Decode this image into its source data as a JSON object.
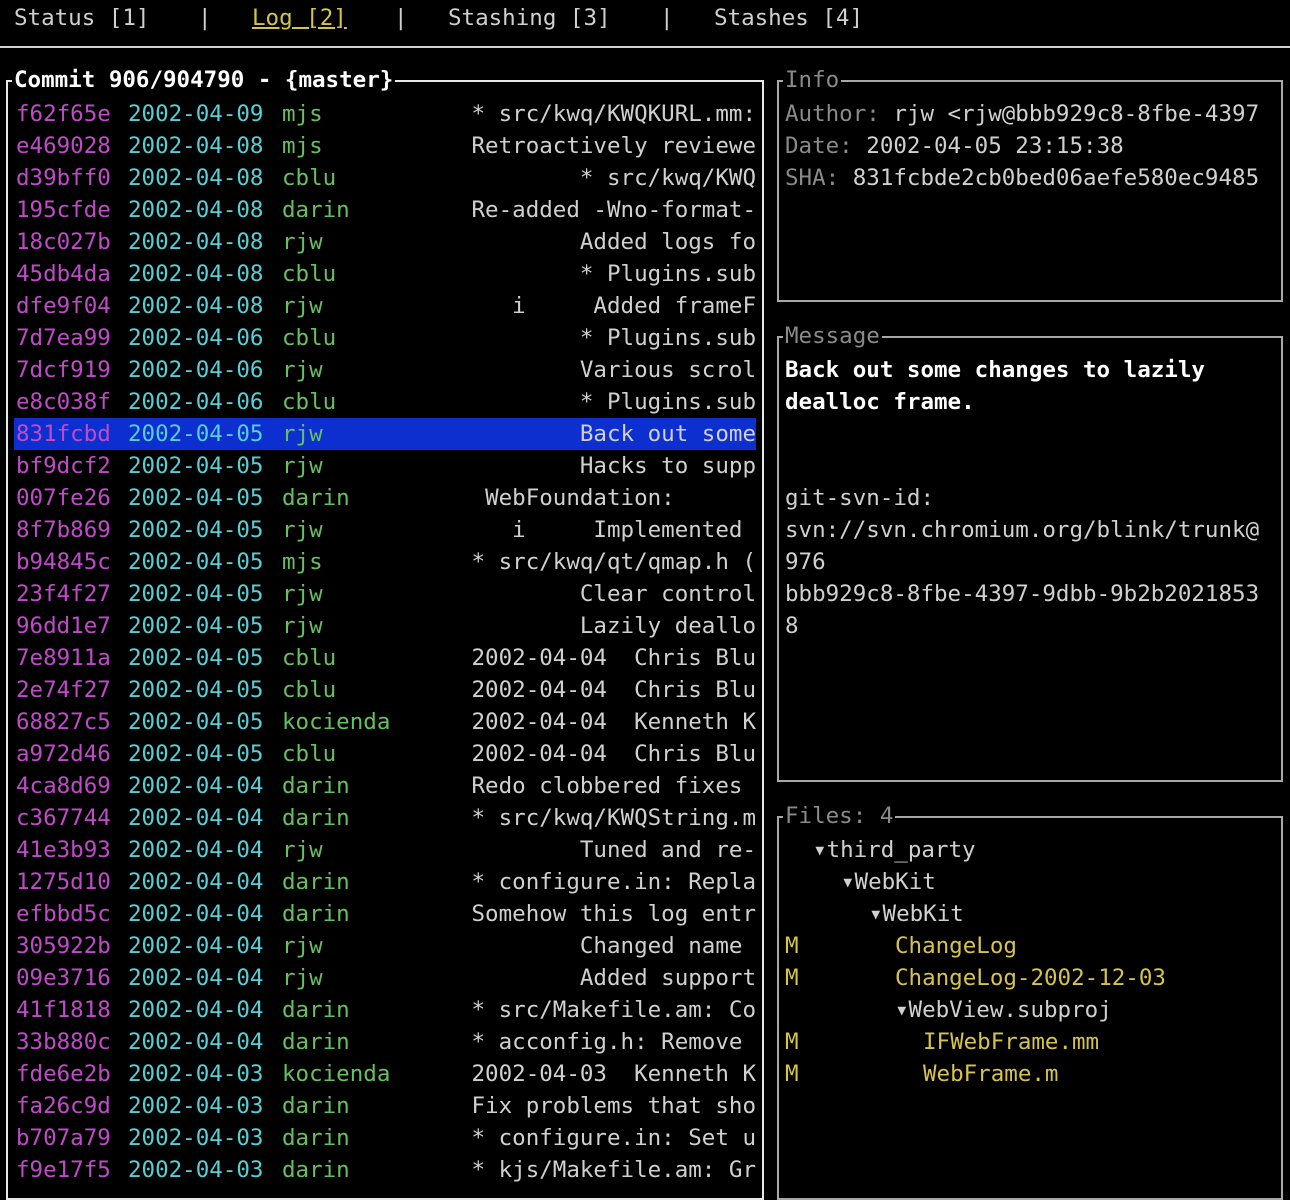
{
  "tabs": [
    {
      "label": "Status [1]",
      "active": false
    },
    {
      "label": "Log [2]",
      "active": true
    },
    {
      "label": "Stashing [3]",
      "active": false
    },
    {
      "label": "Stashes [4]",
      "active": false
    }
  ],
  "tab_separator": "|",
  "log": {
    "title": "Commit 906/904790 - {master}",
    "selected_index": 10,
    "commits": [
      {
        "sha": "f62f65e",
        "date": "2002-04-09",
        "author": "mjs",
        "msg": "* src/kwq/KWQKURL.mm:"
      },
      {
        "sha": "e469028",
        "date": "2002-04-08",
        "author": "mjs",
        "msg": "Retroactively reviewe"
      },
      {
        "sha": "d39bff0",
        "date": "2002-04-08",
        "author": "cblu",
        "msg": "* src/kwq/KWQ"
      },
      {
        "sha": "195cfde",
        "date": "2002-04-08",
        "author": "darin",
        "msg": "Re-added -Wno-format-"
      },
      {
        "sha": "18c027b",
        "date": "2002-04-08",
        "author": "rjw",
        "msg": "Added logs fo"
      },
      {
        "sha": "45db4da",
        "date": "2002-04-08",
        "author": "cblu",
        "msg": "* Plugins.sub"
      },
      {
        "sha": "dfe9f04",
        "date": "2002-04-08",
        "author": "rjw",
        "msg": "i     Added frameF"
      },
      {
        "sha": "7d7ea99",
        "date": "2002-04-06",
        "author": "cblu",
        "msg": "* Plugins.sub"
      },
      {
        "sha": "7dcf919",
        "date": "2002-04-06",
        "author": "rjw",
        "msg": "Various scrol"
      },
      {
        "sha": "e8c038f",
        "date": "2002-04-06",
        "author": "cblu",
        "msg": "* Plugins.sub"
      },
      {
        "sha": "831fcbd",
        "date": "2002-04-05",
        "author": "rjw",
        "msg": "Back out some"
      },
      {
        "sha": "bf9dcf2",
        "date": "2002-04-05",
        "author": "rjw",
        "msg": "Hacks to supp"
      },
      {
        "sha": "007fe26",
        "date": "2002-04-05",
        "author": "darin",
        "msg": "WebFoundation:      "
      },
      {
        "sha": "8f7b869",
        "date": "2002-04-05",
        "author": "rjw",
        "msg": "i     Implemented "
      },
      {
        "sha": "b94845c",
        "date": "2002-04-05",
        "author": "mjs",
        "msg": "* src/kwq/qt/qmap.h ("
      },
      {
        "sha": "23f4f27",
        "date": "2002-04-05",
        "author": "rjw",
        "msg": "Clear control"
      },
      {
        "sha": "96dd1e7",
        "date": "2002-04-05",
        "author": "rjw",
        "msg": "Lazily deallo"
      },
      {
        "sha": "7e8911a",
        "date": "2002-04-05",
        "author": "cblu",
        "msg": "2002-04-04  Chris Blu"
      },
      {
        "sha": "2e74f27",
        "date": "2002-04-05",
        "author": "cblu",
        "msg": "2002-04-04  Chris Blu"
      },
      {
        "sha": "68827c5",
        "date": "2002-04-05",
        "author": "kocienda",
        "msg": "2002-04-04  Kenneth K"
      },
      {
        "sha": "a972d46",
        "date": "2002-04-05",
        "author": "cblu",
        "msg": "2002-04-04  Chris Blu"
      },
      {
        "sha": "4ca8d69",
        "date": "2002-04-04",
        "author": "darin",
        "msg": "Redo clobbered fixes "
      },
      {
        "sha": "c367744",
        "date": "2002-04-04",
        "author": "darin",
        "msg": "* src/kwq/KWQString.m"
      },
      {
        "sha": "41e3b93",
        "date": "2002-04-04",
        "author": "rjw",
        "msg": "Tuned and re-"
      },
      {
        "sha": "1275d10",
        "date": "2002-04-04",
        "author": "darin",
        "msg": "* configure.in: Repla"
      },
      {
        "sha": "efbbd5c",
        "date": "2002-04-04",
        "author": "darin",
        "msg": "Somehow this log entr"
      },
      {
        "sha": "305922b",
        "date": "2002-04-04",
        "author": "rjw",
        "msg": "Changed name "
      },
      {
        "sha": "09e3716",
        "date": "2002-04-04",
        "author": "rjw",
        "msg": "Added support"
      },
      {
        "sha": "41f1818",
        "date": "2002-04-04",
        "author": "darin",
        "msg": "* src/Makefile.am: Co"
      },
      {
        "sha": "33b880c",
        "date": "2002-04-04",
        "author": "darin",
        "msg": "* acconfig.h: Remove "
      },
      {
        "sha": "fde6e2b",
        "date": "2002-04-03",
        "author": "kocienda",
        "msg": "2002-04-03  Kenneth K"
      },
      {
        "sha": "fa26c9d",
        "date": "2002-04-03",
        "author": "darin",
        "msg": "Fix problems that sho"
      },
      {
        "sha": "b707a79",
        "date": "2002-04-03",
        "author": "darin",
        "msg": "* configure.in: Set u"
      },
      {
        "sha": "f9e17f5",
        "date": "2002-04-03",
        "author": "darin",
        "msg": "* kjs/Makefile.am: Gr"
      }
    ]
  },
  "info": {
    "title": "Info",
    "author_label": "Author: ",
    "author_value": "rjw <rjw@bbb929c8-8fbe-4397",
    "date_label": "Date: ",
    "date_value": "2002-04-05 23:15:38",
    "sha_label": "SHA: ",
    "sha_value": "831fcbde2cb0bed06aefe580ec9485"
  },
  "message": {
    "title": "Message",
    "lines": [
      {
        "text": "Back out some changes to lazily",
        "bold": true
      },
      {
        "text": "dealloc frame.",
        "bold": true
      },
      {
        "text": "",
        "bold": false
      },
      {
        "text": "",
        "bold": false
      },
      {
        "text": "git-svn-id:",
        "bold": false
      },
      {
        "text": "svn://svn.chromium.org/blink/trunk@",
        "bold": false
      },
      {
        "text": "976",
        "bold": false
      },
      {
        "text": "bbb929c8-8fbe-4397-9dbb-9b2b2021853",
        "bold": false
      },
      {
        "text": "8",
        "bold": false
      }
    ]
  },
  "files": {
    "title": "Files: 4",
    "tree": [
      {
        "status": "",
        "name": "▾third_party",
        "kind": "dir",
        "depth": 1
      },
      {
        "status": "",
        "name": "▾WebKit",
        "kind": "dir",
        "depth": 2
      },
      {
        "status": "",
        "name": "▾WebKit",
        "kind": "dir",
        "depth": 3
      },
      {
        "status": "M",
        "name": "ChangeLog",
        "kind": "file",
        "depth": 4
      },
      {
        "status": "M",
        "name": "ChangeLog-2002-12-03",
        "kind": "file",
        "depth": 4
      },
      {
        "status": "",
        "name": "▾WebView.subproj",
        "kind": "dir",
        "depth": 4
      },
      {
        "status": "M",
        "name": "IFWebFrame.mm",
        "kind": "file",
        "depth": 5
      },
      {
        "status": "M",
        "name": "WebFrame.m",
        "kind": "file",
        "depth": 5
      }
    ]
  }
}
